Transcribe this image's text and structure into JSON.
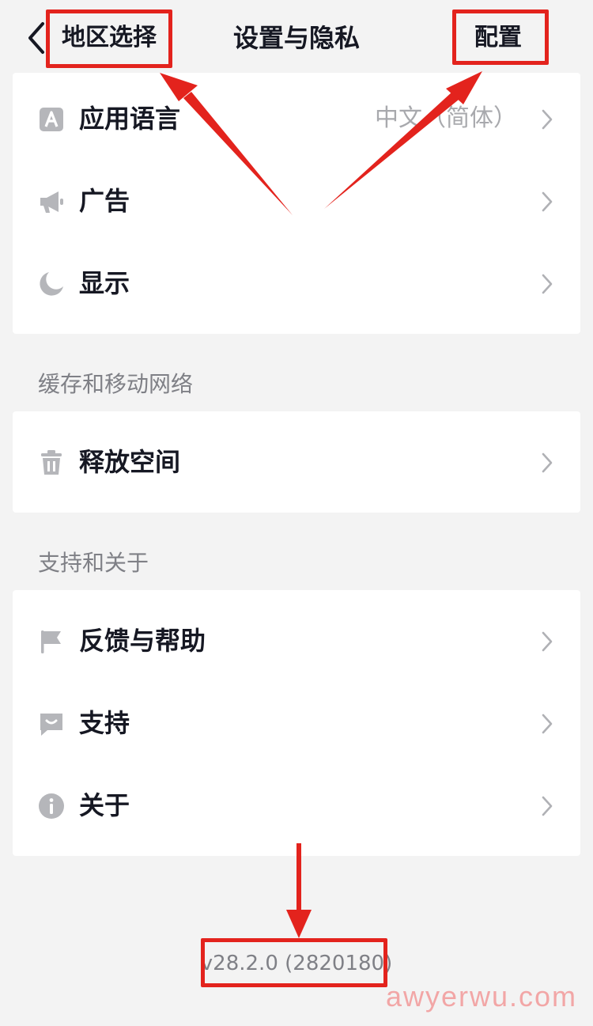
{
  "header": {
    "left_label": "地区选择",
    "title": "设置与隐私",
    "right_label": "配置"
  },
  "card1": [
    {
      "label": "应用语言",
      "value": "中文（简体）",
      "icon": "app-language-icon"
    },
    {
      "label": "广告",
      "value": "",
      "icon": "megaphone-icon"
    },
    {
      "label": "显示",
      "value": "",
      "icon": "moon-icon"
    }
  ],
  "section2": {
    "title": "缓存和移动网络"
  },
  "card2": [
    {
      "label": "释放空间",
      "icon": "trash-icon"
    }
  ],
  "section3": {
    "title": "支持和关于"
  },
  "card3": [
    {
      "label": "反馈与帮助",
      "icon": "flag-icon"
    },
    {
      "label": "支持",
      "icon": "chat-icon"
    },
    {
      "label": "关于",
      "icon": "info-icon"
    }
  ],
  "version": "v28.2.0 (2820180)",
  "watermark": "awyerwu.com",
  "colors": {
    "highlight": "#e3231d",
    "icon": "#b5b6ba",
    "chevron": "#b0b1b5",
    "background": "#f3f3f3"
  }
}
